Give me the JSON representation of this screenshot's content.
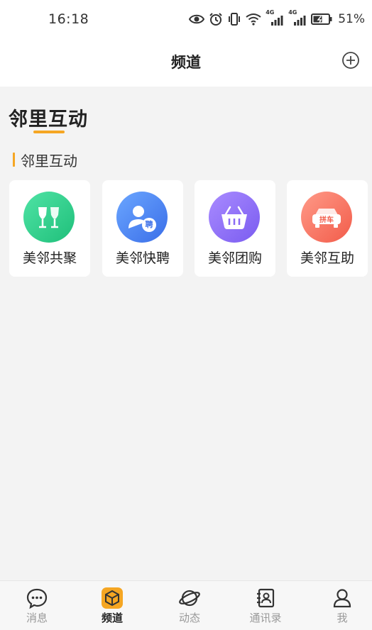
{
  "status_bar": {
    "time": "16:18",
    "network_labels": [
      "4G",
      "4G"
    ],
    "battery": "51%",
    "icons": [
      "eye-icon",
      "alarm-icon",
      "vibrate-icon",
      "wifi-icon",
      "signal-icon",
      "signal-icon",
      "battery-icon"
    ]
  },
  "header": {
    "title": "频道",
    "add_icon": "plus-circle-icon"
  },
  "section": {
    "heading": "邻里互动",
    "subheading": "邻里互动"
  },
  "cards": [
    {
      "label": "美邻共聚",
      "icon": "wine-glasses-icon",
      "color": "#2ecc8a"
    },
    {
      "label": "美邻快聘",
      "icon": "recruit-person-icon",
      "icon_text": "聘",
      "color": "#4a7ff0"
    },
    {
      "label": "美邻团购",
      "icon": "basket-icon",
      "color": "#8a6cf5"
    },
    {
      "label": "美邻互助",
      "icon": "car-icon",
      "icon_text": "拼车",
      "color": "#f36b58"
    }
  ],
  "bottom_nav": {
    "active": "频道",
    "accent": "#f5a623",
    "items": [
      {
        "label": "消息",
        "icon": "chat-bubble-icon"
      },
      {
        "label": "频道",
        "icon": "cube-box-icon"
      },
      {
        "label": "动态",
        "icon": "planet-icon"
      },
      {
        "label": "通讯录",
        "icon": "contacts-book-icon"
      },
      {
        "label": "我",
        "icon": "person-icon"
      }
    ]
  }
}
